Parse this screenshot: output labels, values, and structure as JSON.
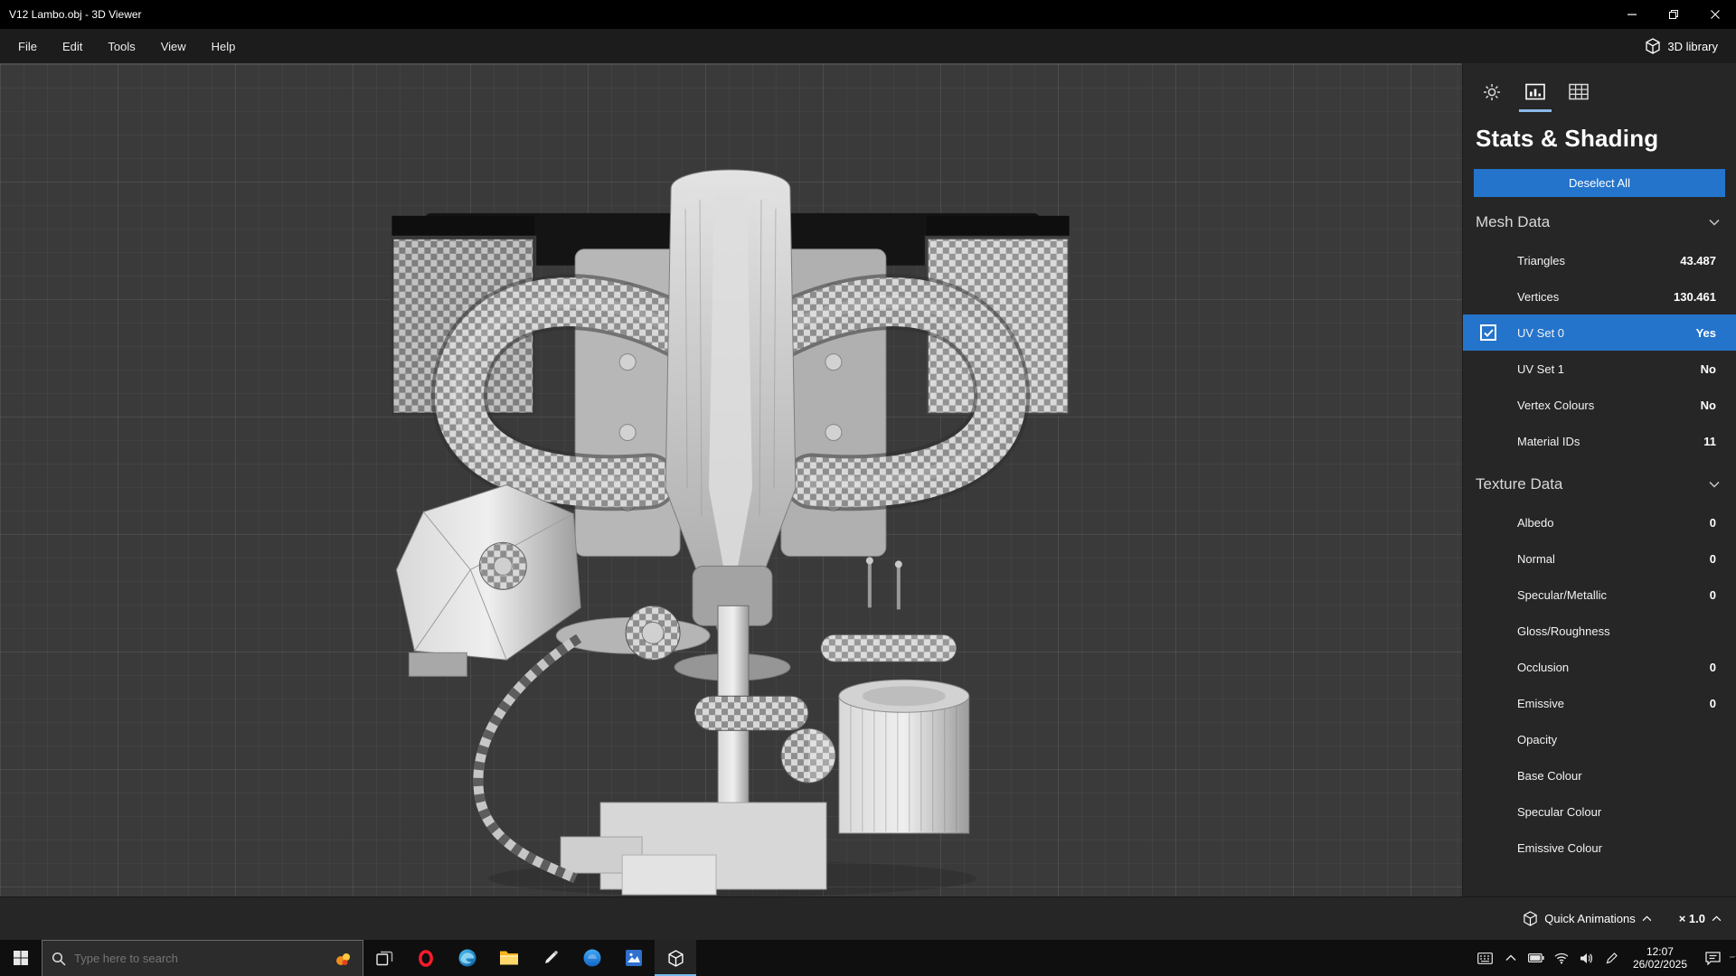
{
  "window": {
    "title": "V12 Lambo.obj - 3D Viewer"
  },
  "menubar": {
    "items": [
      "File",
      "Edit",
      "Tools",
      "View",
      "Help"
    ],
    "library_label": "3D library"
  },
  "panel": {
    "tabs": [
      {
        "name": "lighting",
        "icon": "sun-icon",
        "active": false
      },
      {
        "name": "stats-shading",
        "icon": "stats-chart-icon",
        "active": true
      },
      {
        "name": "grid",
        "icon": "grid-table-icon",
        "active": false
      }
    ],
    "title": "Stats & Shading",
    "deselect_button": "Deselect All",
    "sections": [
      {
        "title": "Mesh Data",
        "rows": [
          {
            "label": "Triangles",
            "value": "43.487"
          },
          {
            "label": "Vertices",
            "value": "130.461"
          },
          {
            "label": "UV Set 0",
            "value": "Yes",
            "selected": true,
            "checked": true
          },
          {
            "label": "UV Set 1",
            "value": "No"
          },
          {
            "label": "Vertex Colours",
            "value": "No"
          },
          {
            "label": "Material IDs",
            "value": "11"
          }
        ]
      },
      {
        "title": "Texture Data",
        "rows": [
          {
            "label": "Albedo",
            "value": "0"
          },
          {
            "label": "Normal",
            "value": "0"
          },
          {
            "label": "Specular/Metallic",
            "value": "0"
          },
          {
            "label": "Gloss/Roughness",
            "value": ""
          },
          {
            "label": "Occlusion",
            "value": "0"
          },
          {
            "label": "Emissive",
            "value": "0"
          },
          {
            "label": "Opacity",
            "value": ""
          },
          {
            "label": "Base Colour",
            "value": ""
          },
          {
            "label": "Specular Colour",
            "value": ""
          },
          {
            "label": "Emissive Colour",
            "value": ""
          }
        ]
      }
    ]
  },
  "animation_bar": {
    "quick_animations_label": "Quick Animations",
    "speed_label": "× 1.0"
  },
  "taskbar": {
    "search_placeholder": "Type here to search",
    "clock": {
      "time": "12:07",
      "date": "26/02/2025"
    }
  },
  "colors": {
    "accent_blue": "#2474cc",
    "selected_row_blue": "#2474cc",
    "tab_underline": "#8ab9e8",
    "viewport_background": "#3a3a3a",
    "panel_background": "#262626",
    "taskbar_background": "#0f0f0f"
  },
  "icons": {
    "panel_tabs": [
      "sun-icon",
      "stats-chart-icon",
      "grid-table-icon"
    ],
    "library": "cube-icon",
    "model_texture": "uv-checker-pattern"
  }
}
